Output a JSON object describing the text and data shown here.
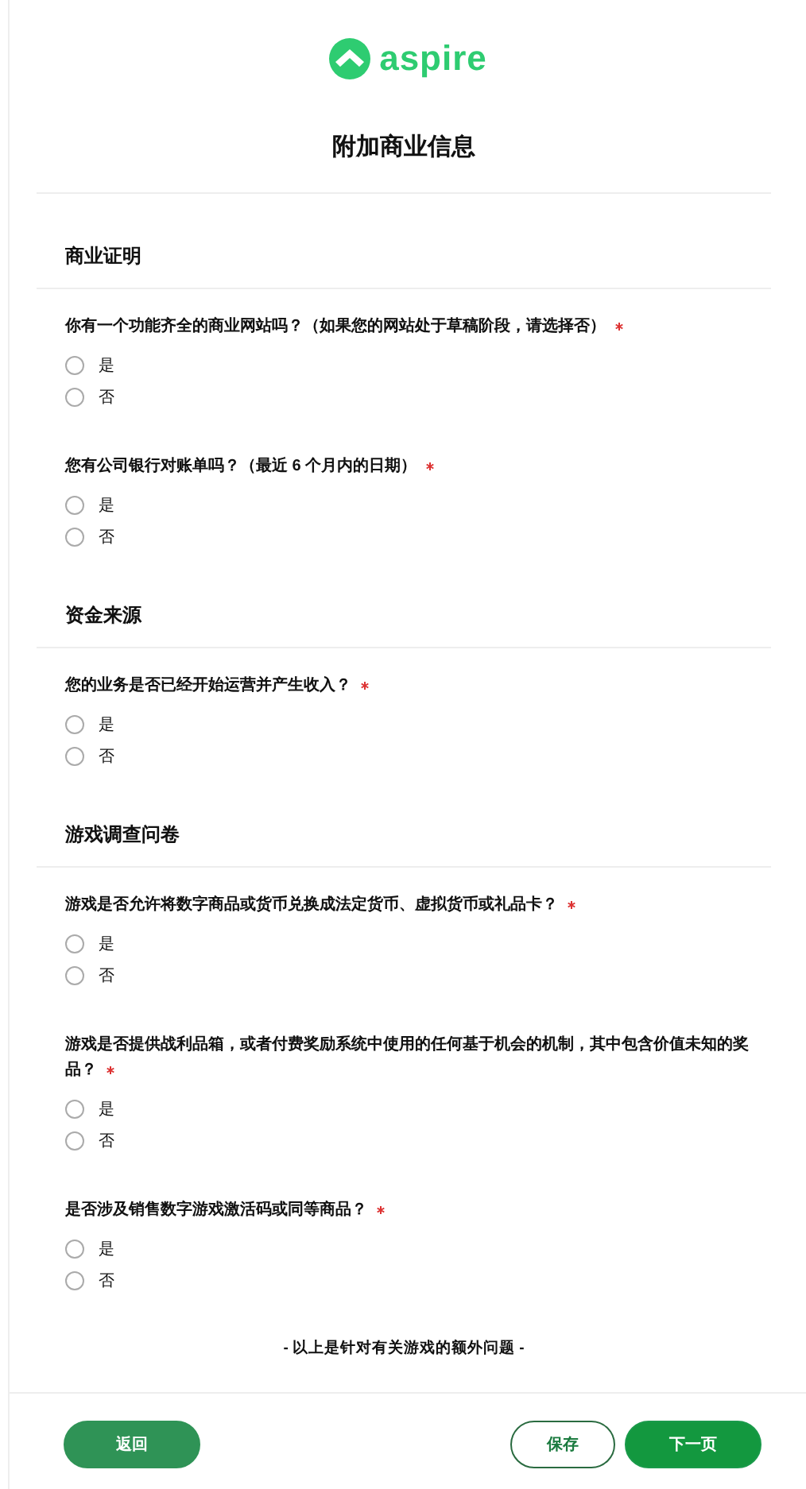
{
  "logo": {
    "text": "aspire"
  },
  "title": "附加商业信息",
  "sections": [
    {
      "title": "商业证明",
      "questions": [
        {
          "text": "你有一个功能齐全的商业网站吗？（如果您的网站处于草稿阶段，请选择否）",
          "required": true,
          "options": [
            {
              "label": "是",
              "selected": false
            },
            {
              "label": "否",
              "selected": false
            }
          ]
        },
        {
          "text": "您有公司银行对账单吗？（最近 6 个月内的日期）",
          "required": true,
          "options": [
            {
              "label": "是",
              "selected": false
            },
            {
              "label": "否",
              "selected": false
            }
          ]
        }
      ]
    },
    {
      "title": "资金来源",
      "questions": [
        {
          "text": "您的业务是否已经开始运营并产生收入？",
          "required": true,
          "options": [
            {
              "label": "是",
              "selected": false
            },
            {
              "label": "否",
              "selected": false
            }
          ]
        }
      ]
    },
    {
      "title": "游戏调查问卷",
      "questions": [
        {
          "text": "游戏是否允许将数字商品或货币兑换成法定货币、虚拟货币或礼品卡？",
          "required": true,
          "options": [
            {
              "label": "是",
              "selected": false
            },
            {
              "label": "否",
              "selected": false
            }
          ]
        },
        {
          "text": "游戏是否提供战利品箱，或者付费奖励系统中使用的任何基于机会的机制，其中包含价值未知的奖品？",
          "required": true,
          "options": [
            {
              "label": "是",
              "selected": false
            },
            {
              "label": "否",
              "selected": false
            }
          ]
        },
        {
          "text": "是否涉及销售数字游戏激活码或同等商品？",
          "required": true,
          "options": [
            {
              "label": "是",
              "selected": false
            },
            {
              "label": "否",
              "selected": false
            }
          ]
        }
      ]
    }
  ],
  "note": "- 以上是针对有关游戏的额外问题 -",
  "buttons": [
    {
      "label": "返回",
      "kind": "back"
    },
    {
      "label": "保存",
      "kind": "outline"
    },
    {
      "label": "下一页",
      "kind": "primary"
    }
  ]
}
